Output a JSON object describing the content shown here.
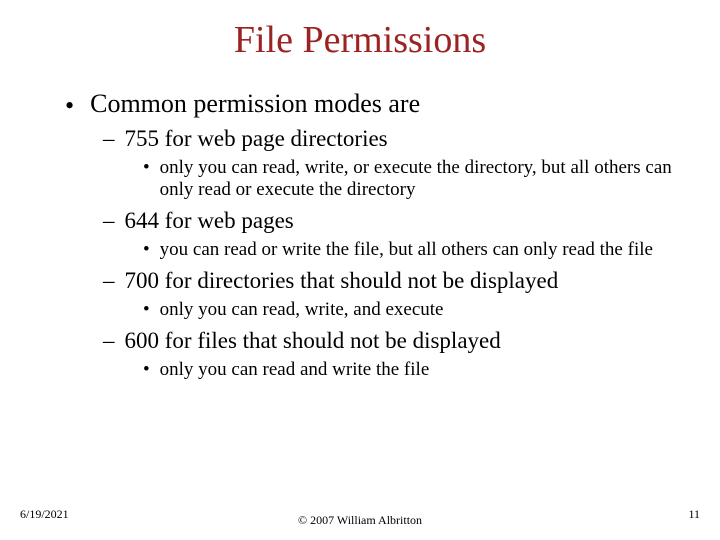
{
  "title": "File Permissions",
  "content": {
    "top": "Common permission modes are",
    "items": [
      {
        "mode": "755 for web page directories",
        "desc": "only you can read, write, or execute the directory, but all others can only read or execute the directory"
      },
      {
        "mode": "644 for web pages",
        "desc": "you can read or write the file, but all others can only read the file"
      },
      {
        "mode": "700 for directories that should not be displayed",
        "desc": "only you can read, write, and execute"
      },
      {
        "mode": "600 for files that should not be displayed",
        "desc": "only you can read and write the file"
      }
    ]
  },
  "footer": {
    "date": "6/19/2021",
    "copyright": "© 2007 William Albritton",
    "page": "11"
  },
  "bullets": {
    "l1": "•",
    "l2": "–",
    "l3": "•"
  }
}
